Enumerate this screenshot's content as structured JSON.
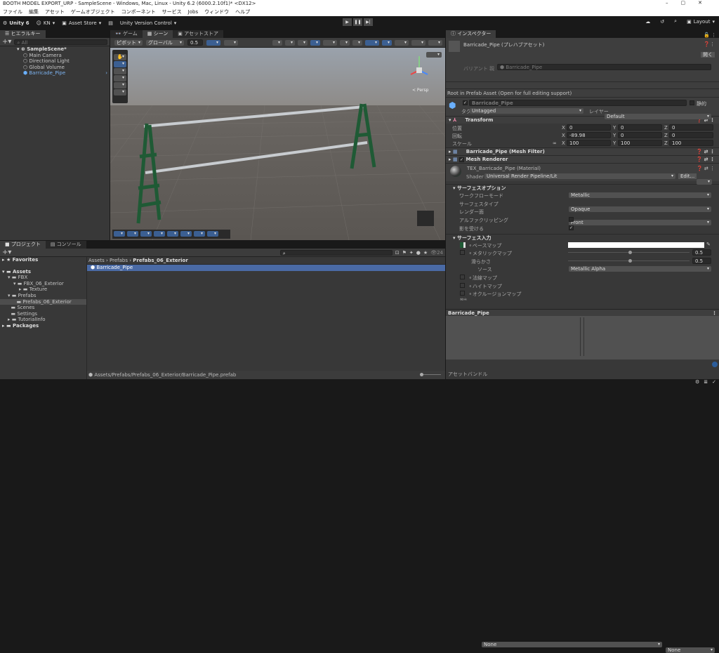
{
  "window": {
    "title": "BOOTH MODEL EXPORT_URP - SampleScene - Windows, Mac, Linux - Unity 6.2 (6000.2.10f1)* <DX12>",
    "controls": [
      "–",
      "▢",
      "✕"
    ]
  },
  "menu": [
    "ファイル",
    "編集",
    "アセット",
    "ゲームオブジェクト",
    "コンポーネント",
    "サービス",
    "Jobs",
    "ウィンドウ",
    "ヘルプ"
  ],
  "toolbar": {
    "unity": "Unity 6",
    "account": "KN",
    "asset_store": "Asset Store",
    "version_control": "Unity Version Control",
    "layout": "Layout"
  },
  "hierarchy": {
    "tab": "ヒエラルキー",
    "search_placeholder": "All",
    "scene": "SampleScene*",
    "items": [
      "Main Camera",
      "Directional Light",
      "Global Volume",
      "Barricade_Pipe"
    ]
  },
  "scene_tabs": [
    "ゲーム",
    "シーン",
    "アセットストア"
  ],
  "scene_toolbar": {
    "pivot": "ピボット",
    "global": "グローバル",
    "snap": "0.5"
  },
  "scene_view": {
    "gizmo_label": "< Persp"
  },
  "inspector": {
    "tab": "インスペクター",
    "header_title": "Barricade_Pipe (プレハブアセット)",
    "open_button": "開く",
    "variant_label": "バリアント 親",
    "variant_value": "Barricade_Pipe",
    "root_notice": "Root in Prefab Asset (Open for full editing support)",
    "object_name": "Barricade_Pipe",
    "static_label": "静的",
    "tag_label": "タグ",
    "tag_value": "Untagged",
    "layer_label": "レイヤー",
    "layer_value": "Default",
    "transform": {
      "title": "Transform",
      "rows": [
        {
          "label": "位置",
          "x": "0",
          "y": "0",
          "z": "0"
        },
        {
          "label": "回転",
          "x": "-89.98",
          "y": "0",
          "z": "0"
        },
        {
          "label": "スケール",
          "x": "100",
          "y": "100",
          "z": "100"
        }
      ]
    },
    "mesh_filter": "Barricade_Pipe (Mesh Filter)",
    "mesh_renderer": "Mesh Renderer",
    "material": "TEX_Barricade_Pipe (Material)",
    "shader_label": "Shader",
    "shader_value": "Universal Render Pipeline/Lit",
    "edit_button": "Edit...",
    "surface_options": {
      "title": "サーフェスオプション",
      "rows": [
        {
          "label": "ワークフローモード",
          "value": "Metallic"
        },
        {
          "label": "サーフェスタイプ",
          "value": "Opaque"
        },
        {
          "label": "レンダー面",
          "value": "Front"
        }
      ],
      "alpha_clip": "アルファクリッピング",
      "receive_shadows": "影を受ける"
    },
    "surface_inputs": {
      "title": "サーフェス入力",
      "base_map": "ベースマップ",
      "metallic_map": "メタリックマップ",
      "metallic_value": "0.5",
      "smoothness": "滑らかさ",
      "smoothness_value": "0.5",
      "source": "ソース",
      "source_value": "Metallic Alpha",
      "normal_map": "法線マップ",
      "height_map": "ハイトマップ",
      "occlusion_map": "オクルージョンマップ",
      "emission": "放出"
    },
    "preview_title": "Barricade_Pipe",
    "asset_bundle_label": "アセットバンドル",
    "asset_bundle_value": "None",
    "asset_bundle_variant": "None"
  },
  "project": {
    "tabs": [
      "プロジェクト",
      "コンソール"
    ],
    "hidden_count": "24",
    "tree": [
      {
        "label": "Favorites",
        "d": 0
      },
      {
        "label": "Assets",
        "d": 0
      },
      {
        "label": "FBX",
        "d": 1
      },
      {
        "label": "FBX_06_Exterior",
        "d": 2
      },
      {
        "label": "Texture",
        "d": 3
      },
      {
        "label": "Prefabs",
        "d": 1
      },
      {
        "label": "Prefabs_06_Exterior",
        "d": 2
      },
      {
        "label": "Scenes",
        "d": 1
      },
      {
        "label": "Settings",
        "d": 1
      },
      {
        "label": "TutorialInfo",
        "d": 1
      },
      {
        "label": "Packages",
        "d": 0
      }
    ],
    "breadcrumb": [
      "Assets",
      "Prefabs",
      "Prefabs_06_Exterior"
    ],
    "files": [
      "Barricade_Pipe"
    ],
    "path": "Assets/Prefabs/Prefabs_06_Exterior/Barricade_Pipe.prefab"
  }
}
